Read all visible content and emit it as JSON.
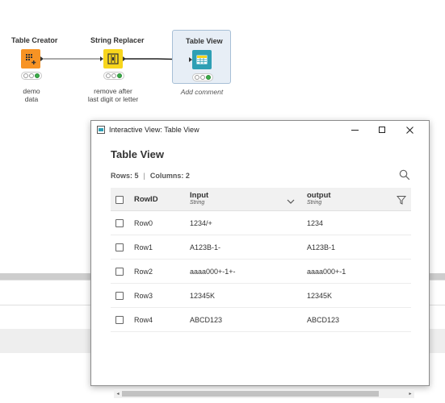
{
  "workflow": {
    "nodes": [
      {
        "title": "Table Creator",
        "label": "demo data"
      },
      {
        "title": "String Replacer",
        "label_line1": "remove after",
        "label_line2": "last digit or letter"
      },
      {
        "title": "Table View",
        "label": "Add comment"
      }
    ]
  },
  "window": {
    "title": "Interactive View: Table View",
    "controls": {
      "minimize": "minimize",
      "maximize": "maximize",
      "close": "×"
    }
  },
  "view": {
    "heading": "Table View",
    "rows_label": "Rows: 5",
    "separator": "|",
    "columns_label": "Columns: 2"
  },
  "table": {
    "columns": [
      {
        "name": "RowID",
        "type": ""
      },
      {
        "name": "Input",
        "type": "String"
      },
      {
        "name": "output",
        "type": "String"
      }
    ],
    "rows": [
      {
        "id": "Row0",
        "input": "1234/+",
        "output": "1234"
      },
      {
        "id": "Row1",
        "input": "A123B-1-",
        "output": "A123B-1"
      },
      {
        "id": "Row2",
        "input": "aaaa000+-1+-",
        "output": "aaaa000+-1"
      },
      {
        "id": "Row3",
        "input": "12345K",
        "output": "12345K"
      },
      {
        "id": "Row4",
        "input": "ABCD123",
        "output": "ABCD123"
      }
    ]
  },
  "icons": {
    "search": "search-icon",
    "sort": "chevron-down-icon",
    "filter": "filter-icon",
    "scroll_left": "◂",
    "scroll_right": "▸"
  },
  "colors": {
    "table_creator": "#f79324",
    "string_replacer": "#f7d51c",
    "table_view": "#2e9fb4",
    "status_green": "#3cae4a"
  }
}
